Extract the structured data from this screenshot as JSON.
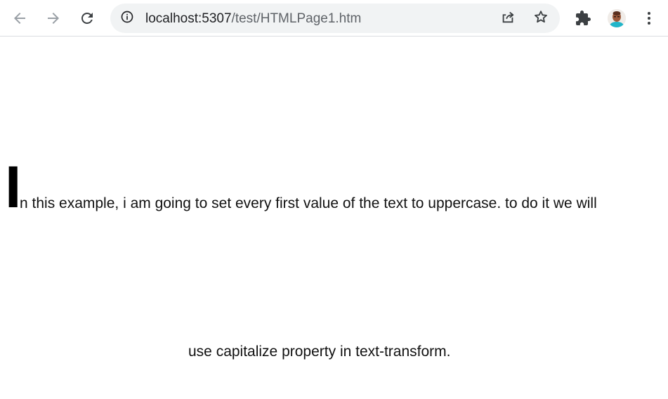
{
  "browser": {
    "url_host": "localhost:5307",
    "url_path": "/test/HTMLPage1.htm"
  },
  "icons": {
    "back": "back-arrow-icon",
    "forward": "forward-arrow-icon",
    "reload": "reload-icon",
    "site_info": "info-icon",
    "share": "share-icon",
    "bookmark": "star-icon",
    "extensions": "puzzle-icon",
    "profile": "avatar",
    "menu": "kebab-menu-icon"
  },
  "page": {
    "first_letter": "I",
    "first_line_rest": "n this example, i am going to set every first value of the text to uppercase. to do it we will",
    "second_line": "use capitalize property in text-transform."
  },
  "colors": {
    "toolbar_bg": "#ffffff",
    "omnibox_bg": "#f1f3f4",
    "icon": "#5f6368",
    "text": "#111111"
  }
}
